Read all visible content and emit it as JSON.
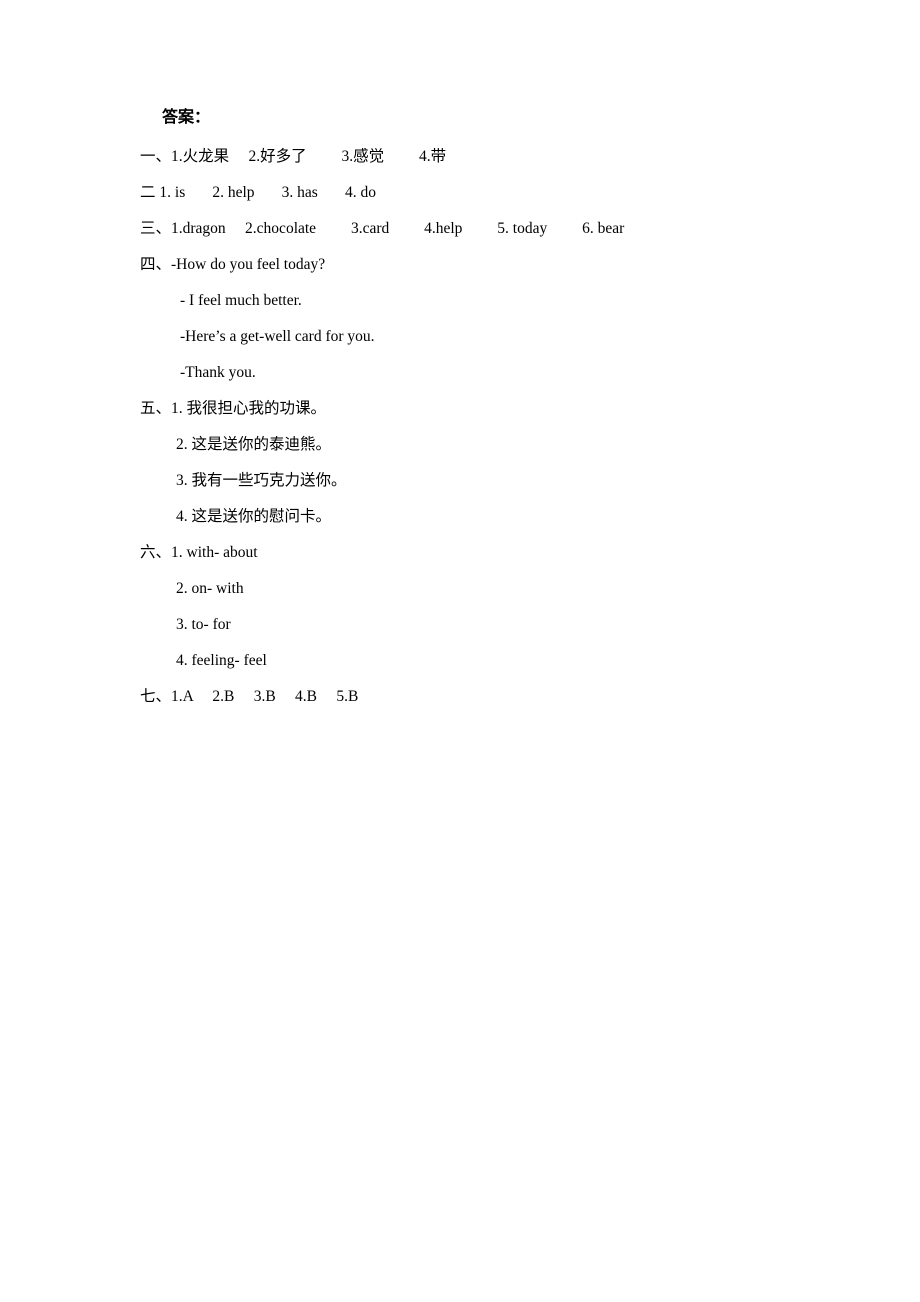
{
  "document": {
    "heading": "答案：",
    "sections": [
      {
        "id": "section-1",
        "marker": "一、",
        "lines": [
          {
            "id": "s1-l1",
            "indent": "none",
            "text": "1.火龙果　 2.好多了　　 3.感觉　　 4.带"
          }
        ]
      },
      {
        "id": "section-2",
        "marker": "二 ",
        "lines": [
          {
            "id": "s2-l1",
            "indent": "none",
            "text": "1. is　   2. help　   3. has　   4. do"
          }
        ]
      },
      {
        "id": "section-3",
        "marker": "三、",
        "lines": [
          {
            "id": "s3-l1",
            "indent": "none",
            "text": "1.dragon　 2.chocolate　　 3.card　　 4.help　　 5. today　　 6. bear"
          }
        ]
      },
      {
        "id": "section-4",
        "marker": "四、",
        "lines": [
          {
            "id": "s4-l1",
            "indent": "none",
            "text": "-How do you feel today?"
          },
          {
            "id": "s4-l2",
            "indent": "sub-en",
            "text": "- I feel much better."
          },
          {
            "id": "s4-l3",
            "indent": "sub-en",
            "text": "-Here’s a get-well card for you."
          },
          {
            "id": "s4-l4",
            "indent": "sub-en",
            "text": "-Thank you."
          }
        ]
      },
      {
        "id": "section-5",
        "marker": "五、",
        "lines": [
          {
            "id": "s5-l1",
            "indent": "none",
            "text": "1. 我很担心我的功课。"
          },
          {
            "id": "s5-l2",
            "indent": "sub",
            "text": "2. 这是送你的泰迪熊。"
          },
          {
            "id": "s5-l3",
            "indent": "sub",
            "text": "3. 我有一些巧克力送你。"
          },
          {
            "id": "s5-l4",
            "indent": "sub",
            "text": "4. 这是送你的慰问卡。"
          }
        ]
      },
      {
        "id": "section-6",
        "marker": "六、",
        "lines": [
          {
            "id": "s6-l1",
            "indent": "none",
            "text": "1. with- about"
          },
          {
            "id": "s6-l2",
            "indent": "sub",
            "text": "2. on- with"
          },
          {
            "id": "s6-l3",
            "indent": "sub",
            "text": "3. to- for"
          },
          {
            "id": "s6-l4",
            "indent": "sub",
            "text": "4. feeling- feel"
          }
        ]
      },
      {
        "id": "section-7",
        "marker": "七、",
        "lines": [
          {
            "id": "s7-l1",
            "indent": "none",
            "text": "1.A　 2.B　 3.B　 4.B　 5.B"
          }
        ]
      }
    ]
  }
}
